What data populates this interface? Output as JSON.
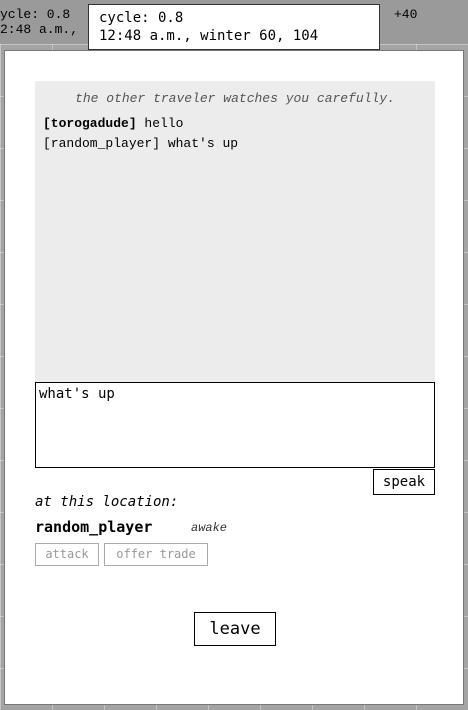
{
  "background": {
    "left_line1": "ycle: 0.8",
    "left_line2": "2:48 a.m.,",
    "right_text": "+40"
  },
  "tooltip": {
    "cycle": "cycle: 0.8",
    "time": "12:48 a.m., winter 60, 104"
  },
  "chat": {
    "note": "the other traveler watches you carefully.",
    "messages": [
      {
        "name": "[torogadude]",
        "text": " hello"
      },
      {
        "name": "[random_player]",
        "text": " what's up"
      }
    ],
    "input_value": "what's up",
    "speak_label": "speak"
  },
  "location": {
    "heading": "at this location:",
    "player_name": "random_player",
    "player_status": "awake",
    "attack_label": "attack",
    "trade_label": "offer trade"
  },
  "leave_label": "leave"
}
